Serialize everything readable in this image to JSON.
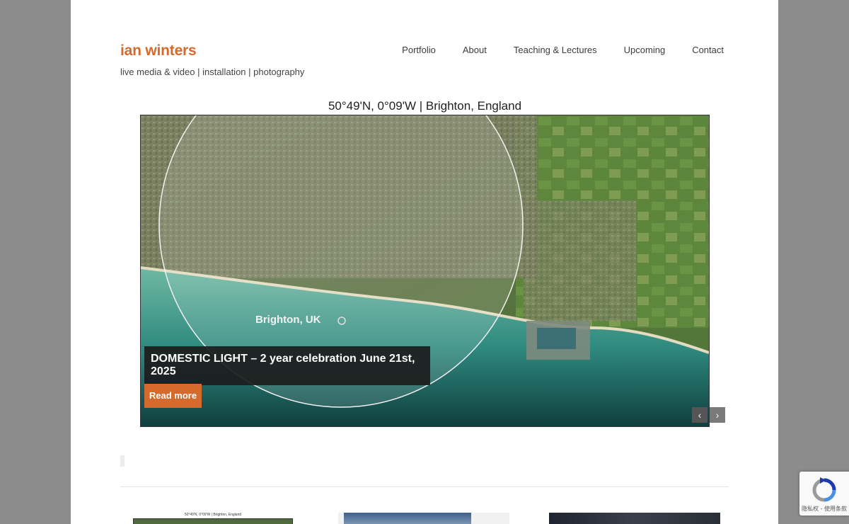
{
  "site": {
    "title": "ian winters",
    "tagline": "live media & video | installation | photography"
  },
  "nav": {
    "items": [
      "Portfolio",
      "About",
      "Teaching & Lectures",
      "Upcoming",
      "Contact"
    ]
  },
  "slider": {
    "header_text": "50°49'N, 0°09'W | Brighton, England",
    "map_label": "Brighton, UK",
    "slide_title": "DOMESTIC LIGHT – 2 year celebration June 21st, 2025",
    "read_more_label": "Read more",
    "prev_symbol": "‹",
    "next_symbol": "›"
  },
  "thumbnails": {
    "first_caption": "50°49'N, 0°09'W | Brighton, England"
  },
  "recaptcha": {
    "footer_text": "隐私权 - 使用条款"
  },
  "colors": {
    "accent": "#d56a2c",
    "page_background": "#8c8c8c",
    "content_background": "#ffffff"
  }
}
